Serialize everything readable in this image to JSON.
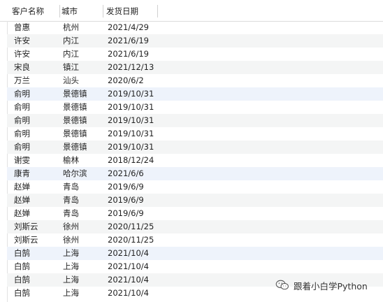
{
  "table": {
    "columns": [
      "客户名称",
      "城市",
      "发货日期"
    ],
    "rows": [
      {
        "name": "曾惠",
        "city": "杭州",
        "date": "2021/4/29"
      },
      {
        "name": "许安",
        "city": "内江",
        "date": "2021/6/19"
      },
      {
        "name": "许安",
        "city": "内江",
        "date": "2021/6/19"
      },
      {
        "name": "宋良",
        "city": "镇江",
        "date": "2021/12/13"
      },
      {
        "name": "万兰",
        "city": "汕头",
        "date": "2020/6/2"
      },
      {
        "name": "俞明",
        "city": "景德镇",
        "date": "2019/10/31"
      },
      {
        "name": "俞明",
        "city": "景德镇",
        "date": "2019/10/31"
      },
      {
        "name": "俞明",
        "city": "景德镇",
        "date": "2019/10/31"
      },
      {
        "name": "俞明",
        "city": "景德镇",
        "date": "2019/10/31"
      },
      {
        "name": "俞明",
        "city": "景德镇",
        "date": "2019/10/31"
      },
      {
        "name": "谢雯",
        "city": "榆林",
        "date": "2018/12/24"
      },
      {
        "name": "康青",
        "city": "哈尔滨",
        "date": "2021/6/6"
      },
      {
        "name": "赵婵",
        "city": "青岛",
        "date": "2019/6/9"
      },
      {
        "name": "赵婵",
        "city": "青岛",
        "date": "2019/6/9"
      },
      {
        "name": "赵婵",
        "city": "青岛",
        "date": "2019/6/9"
      },
      {
        "name": "刘斯云",
        "city": "徐州",
        "date": "2020/11/25"
      },
      {
        "name": "刘斯云",
        "city": "徐州",
        "date": "2020/11/25"
      },
      {
        "name": "白鹄",
        "city": "上海",
        "date": "2021/10/4"
      },
      {
        "name": "白鹄",
        "city": "上海",
        "date": "2021/10/4"
      },
      {
        "name": "白鹄",
        "city": "上海",
        "date": "2021/10/4"
      },
      {
        "name": "白鹄",
        "city": "上海",
        "date": "2021/10/4"
      }
    ],
    "highlighted_rows": [
      5,
      11,
      17
    ]
  },
  "watermark": {
    "icon": "wechat-icon",
    "text": "跟着小白学Python"
  },
  "colors": {
    "alt_row": "#f4f5f5",
    "highlight_row": "#eef3fb"
  }
}
